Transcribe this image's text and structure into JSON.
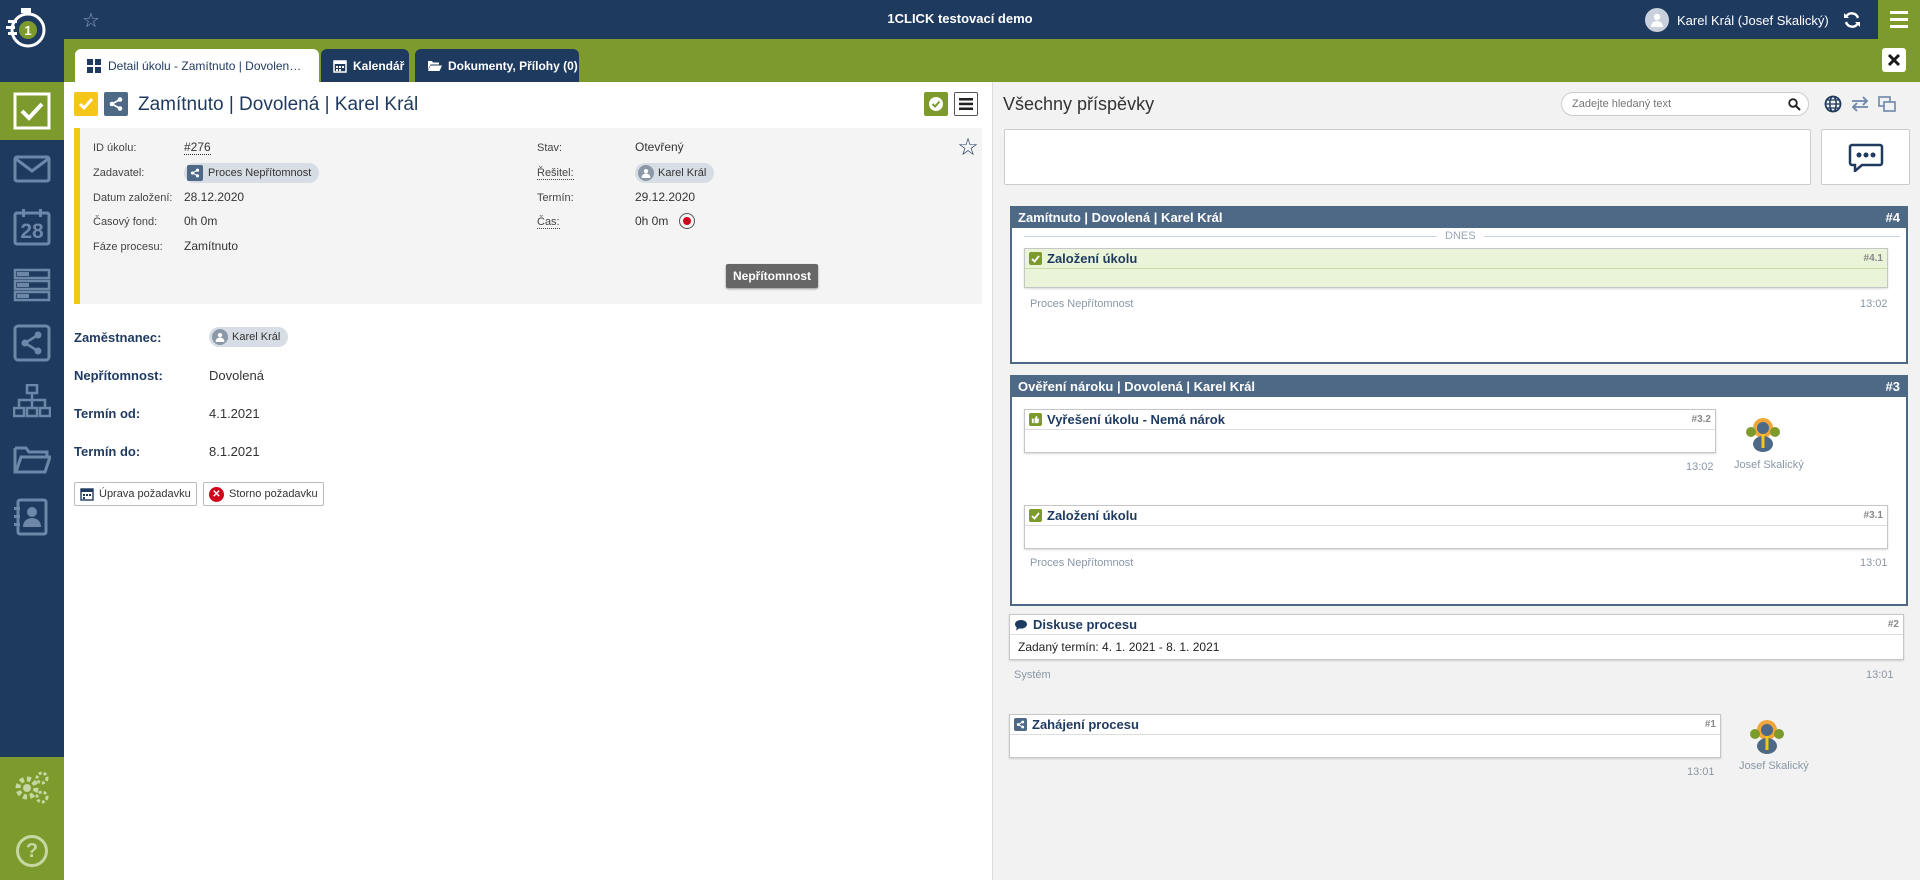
{
  "app": {
    "title": "1CLICK testovací demo",
    "user": "Karel Král (Josef Skalický)"
  },
  "tabs": [
    {
      "label": "Detail úkolu - Zamítnuto | Dovolená ..."
    },
    {
      "label": "Kalendář"
    },
    {
      "label": "Dokumenty, Přílohy (0)"
    }
  ],
  "sidebar": {
    "items": [
      "tasks",
      "mail",
      "calendar-28",
      "list",
      "process",
      "org-chart",
      "folder",
      "contacts"
    ],
    "calendar_day": "28",
    "bottom": [
      "settings",
      "help"
    ]
  },
  "task": {
    "title": "Zamítnuto | Dovolená | Karel Král",
    "labels": {
      "id": "ID úkolu:",
      "requester": "Zadavatel:",
      "created": "Datum založení:",
      "time_fund": "Časový fond:",
      "phase": "Fáze procesu:",
      "state": "Stav:",
      "solver": "Řešitel:",
      "deadline": "Termín:",
      "time": "Čas:"
    },
    "id": "#276",
    "requester": "Proces Nepřítomnost",
    "created": "28.12.2020",
    "time_fund": "0h 0m",
    "phase": "Zamítnuto",
    "state": "Otevřený",
    "solver": "Karel Král",
    "deadline": "29.12.2020",
    "time": "0h 0m",
    "category": "Nepřítomnost"
  },
  "form": {
    "fields": [
      {
        "label": "Zaměstnanec:",
        "value": "Karel Král"
      },
      {
        "label": "Nepřítomnost:",
        "value": "Dovolená"
      },
      {
        "label": "Termín od:",
        "value": "4.1.2021"
      },
      {
        "label": "Termín do:",
        "value": "8.1.2021"
      }
    ],
    "edit_button": "Úprava požadavku",
    "cancel_button": "Storno požadavku"
  },
  "posts": {
    "title": "Všechny příspěvky",
    "search_placeholder": "Zadejte hledaný text",
    "groups": [
      {
        "title": "Zamítnuto | Dovolená | Karel Král",
        "num": "#4",
        "separator": "DNES",
        "cards": [
          {
            "title": "Založení úkolu",
            "num": "#4.1",
            "author": "Proces Nepřítomnost",
            "time": "13:02"
          }
        ]
      },
      {
        "title": "Ověření nároku | Dovolená | Karel Král",
        "num": "#3",
        "cards": [
          {
            "title": "Vyřešení úkolu - Nemá nárok",
            "num": "#3.2",
            "author": "Josef Skalický",
            "time": "13:02"
          },
          {
            "title": "Založení úkolu",
            "num": "#3.1",
            "author": "Proces Nepřítomnost",
            "time": "13:01"
          }
        ]
      }
    ],
    "discussion": {
      "title": "Diskuse procesu",
      "num": "#2",
      "body": "Zadaný termín: 4. 1. 2021 - 8. 1. 2021",
      "author": "Systém",
      "time": "13:01"
    },
    "start": {
      "title": "Zahájení procesu",
      "num": "#1",
      "author": "Josef Skalický",
      "time": "13:01"
    }
  },
  "colors": {
    "navy": "#1f3a5f",
    "green": "#7c9b2c",
    "yellow": "#f5c518",
    "group_header": "#4e6985"
  }
}
